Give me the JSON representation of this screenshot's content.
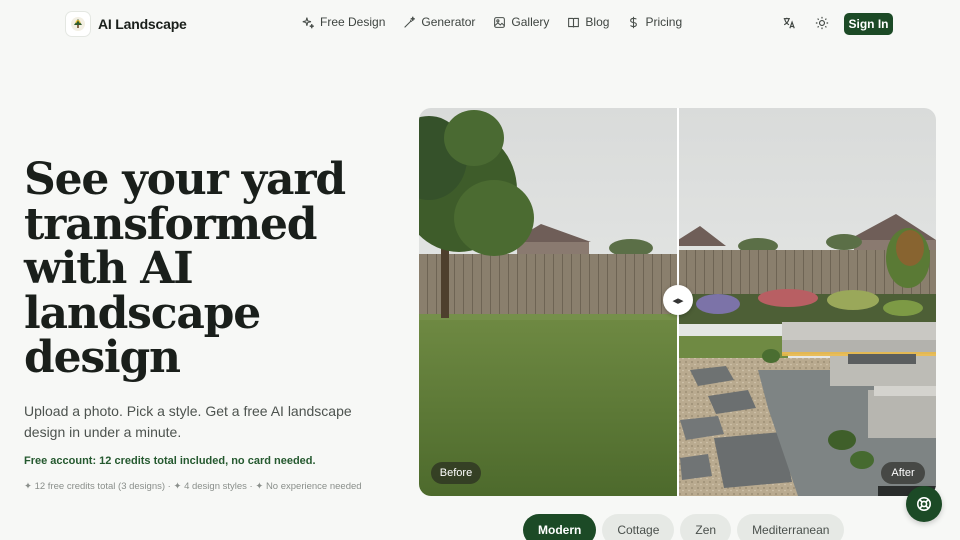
{
  "brand": {
    "name": "AI Landscape",
    "logo_icon": "tree-logo-icon",
    "accent": "#1c4a26"
  },
  "nav": {
    "items": [
      {
        "label": "Free Design",
        "icon": "sparkle-icon"
      },
      {
        "label": "Generator",
        "icon": "magic-wand-icon"
      },
      {
        "label": "Gallery",
        "icon": "image-icon"
      },
      {
        "label": "Blog",
        "icon": "book-icon"
      },
      {
        "label": "Pricing",
        "icon": "dollar-icon"
      }
    ],
    "sign_in": "Sign In"
  },
  "hero": {
    "title": "See your yard transformed with AI landscape design",
    "subtitle": "Upload a photo. Pick a style. Get a free AI landscape design in under a minute.",
    "free_note": "Free account: 12 credits total included, no card needed.",
    "features": "✦ 12 free credits total (3 designs) · ✦ 4 design styles · ✦ No experience needed"
  },
  "compare": {
    "before_label": "Before",
    "after_label": "After",
    "slider_position": 0.5
  },
  "styles": {
    "selected": "Modern",
    "options": [
      "Modern",
      "Cottage",
      "Zen",
      "Mediterranean"
    ]
  }
}
